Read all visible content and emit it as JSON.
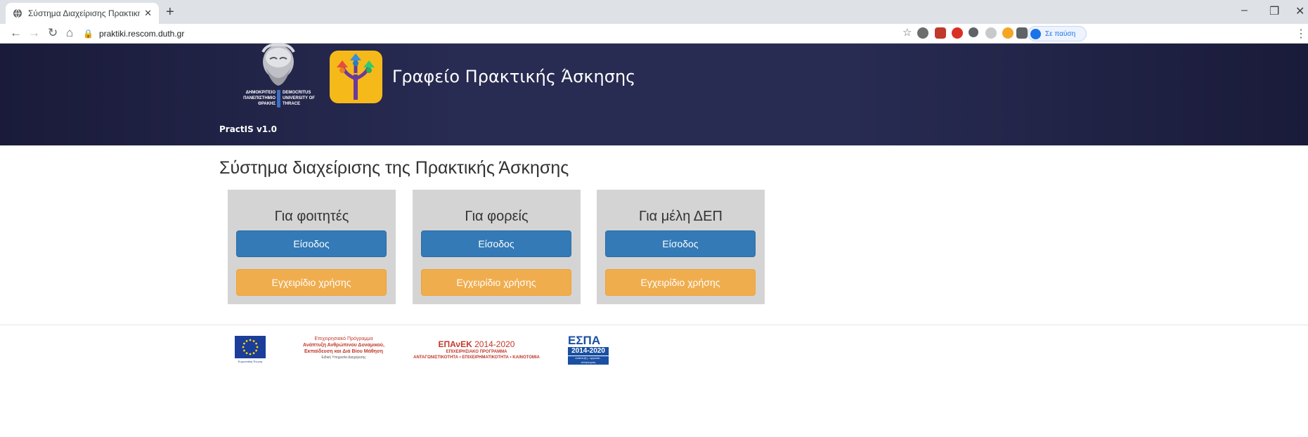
{
  "browser": {
    "tab_title": "Σύστημα Διαχείρισης Πρακτική",
    "tab_close": "✕",
    "new_tab": "+",
    "url": "praktiki.rescom.duth.gr",
    "profile_label": "Σε παύση",
    "window_controls": {
      "minimize": "–",
      "maximize": "❐",
      "close": "✕"
    },
    "icons": [
      "back-icon",
      "forward-icon",
      "reload-icon",
      "home-icon",
      "lock-icon",
      "star-icon",
      "menu-dots-icon"
    ]
  },
  "header": {
    "university_gr": "ΔΗΜΟΚΡΙΤΕΙΟ ΠΑΝΕΠΙΣΤΗΜΙΟ ΘΡΑΚΗΣ",
    "university_en": "DEMOCRITUS UNIVERSITY OF THRACE",
    "title": "Γραφείο Πρακτικής Άσκησης",
    "version": "PractIS v1.0"
  },
  "main": {
    "heading": "Σύστημα διαχείρισης της Πρακτικής Άσκησης",
    "cards": [
      {
        "title": "Για φοιτητές",
        "login": "Είσοδος",
        "manual": "Εγχειρίδιο χρήσης"
      },
      {
        "title": "Για φορείς",
        "login": "Είσοδος",
        "manual": "Εγχειρίδιο χρήσης"
      },
      {
        "title": "Για μέλη ΔΕΠ",
        "login": "Είσοδος",
        "manual": "Εγχειρίδιο χρήσης"
      }
    ]
  },
  "footer": {
    "eu_caption": "Ευρωπαϊκή Ένωση",
    "program_line1": "Επιχειρησιακό Πρόγραμμα",
    "program_line2": "Ανάπτυξη Ανθρώπινου Δυναμικού,",
    "program_line3": "Εκπαίδευση και Διά Βίου Μάθηση",
    "program_line4": "Ειδική Υπηρεσία Διαχείρισης",
    "epanek_name": "ΕΠΑνΕΚ",
    "epanek_years": "2014-2020",
    "epanek_line2": "ΕΠΙΧΕΙΡΗΣΙΑΚΟ ΠΡΟΓΡΑΜΜΑ",
    "epanek_line3": "ΑΝΤΑΓΩΝΙΣΤΙΚΟΤΗΤΑ • ΕΠΙΧΕΙΡΗΜΑΤΙΚΟΤΗΤΑ • ΚΑΙΝΟΤΟΜΙΑ",
    "espa_name": "ΕΣΠΑ",
    "espa_years": "2014-2020",
    "espa_tagline": "ανάπτυξη - εργασία - αλληλεγγύη"
  },
  "colors": {
    "header_bg": "#282b52",
    "login_button": "#337ab7",
    "manual_button": "#f0ad4e",
    "card_bg": "#d4d4d4",
    "app_logo_bg": "#f6b91a"
  }
}
